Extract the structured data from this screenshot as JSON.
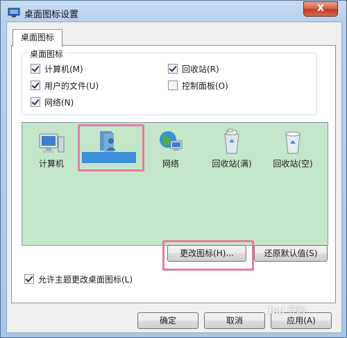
{
  "window": {
    "title": "桌面图标设置",
    "close_label": "X"
  },
  "tab": {
    "label": "桌面图标"
  },
  "group": {
    "title": "桌面图标",
    "items": [
      {
        "label": "计算机(M)",
        "checked": true
      },
      {
        "label": "回收站(R)",
        "checked": true
      },
      {
        "label": "用户的文件(U)",
        "checked": true
      },
      {
        "label": "控制面板(O)",
        "checked": false
      },
      {
        "label": "网络(N)",
        "checked": true
      }
    ]
  },
  "icons": [
    {
      "name": "computer-icon",
      "label": "计算机"
    },
    {
      "name": "user-files-icon",
      "label": ""
    },
    {
      "name": "network-icon",
      "label": "网络"
    },
    {
      "name": "recycle-bin-full-icon",
      "label": "回收站(满)"
    },
    {
      "name": "recycle-bin-empty-icon",
      "label": "回收站(空)"
    }
  ],
  "buttons": {
    "change_icon": "更改图标(H)...",
    "restore_default": "还原默认值(S)",
    "ok": "确定",
    "cancel": "取消",
    "apply": "应用(A)"
  },
  "allow_themes": {
    "label": "允许主题更改桌面图标(L)",
    "checked": true
  },
  "watermark": {
    "text": "Bai 经验"
  },
  "colors": {
    "highlight": "#e57ca2",
    "list_bg": "#c6e6ca",
    "selection": "#3c8fd9"
  }
}
